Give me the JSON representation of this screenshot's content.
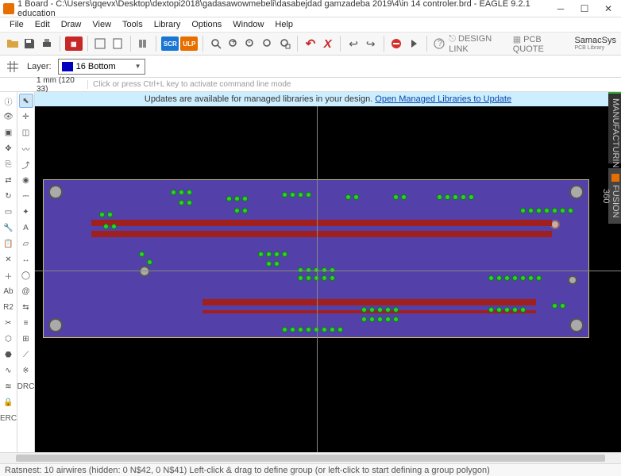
{
  "window": {
    "title": "1 Board - C:\\Users\\gqevx\\Desktop\\dextopi2018\\gadasawowmebeli\\dasabejdad gamzadeba 2019\\4\\in 14 controler.brd - EAGLE 9.2.1 education"
  },
  "menu": {
    "items": [
      "File",
      "Edit",
      "Draw",
      "View",
      "Tools",
      "Library",
      "Options",
      "Window",
      "Help"
    ]
  },
  "toolbar_badges": {
    "scr": "SCR",
    "ulp": "ULP"
  },
  "layerbar": {
    "label": "Layer:",
    "selected": "16 Bottom"
  },
  "cmdbar": {
    "coord": "1 mm (120 33)",
    "placeholder": "Click or press Ctrl+L key to activate command line mode"
  },
  "notice": {
    "text": "Updates are available for managed libraries in your design.",
    "link": "Open Managed Libraries to Update"
  },
  "sidetabs": {
    "t1": "MANUFACTURING",
    "t2": "FUSION 360"
  },
  "logos": {
    "design_link": "DESIGN LINK",
    "pcb_quote": "PCB QUOTE",
    "samacsys": "SamacSys",
    "samacsys_sub": "PCB Library"
  },
  "status": {
    "text": "Ratsnest: 10 airwires (hidden: 0 N$42, 0 N$41) Left-click & drag to define group (or left-click to start defining a group polygon)"
  },
  "vtoolA_tips": [
    "info",
    "show",
    "layers",
    "move",
    "copy",
    "mirror",
    "rotate",
    "group",
    "change",
    "paste",
    "delete",
    "add",
    "name",
    "value",
    "smash",
    "miter",
    "split",
    "optimize",
    "meander",
    "lock",
    "erc"
  ],
  "vtoolB_tips": [
    "select",
    "mark",
    "grid",
    "route",
    "ripup",
    "via",
    "signal",
    "ratsnest",
    "text",
    "polygon",
    "dimension",
    "hole",
    "attribute",
    "pinswap",
    "replace",
    "distribute",
    "slice",
    "fanout",
    "drc"
  ]
}
